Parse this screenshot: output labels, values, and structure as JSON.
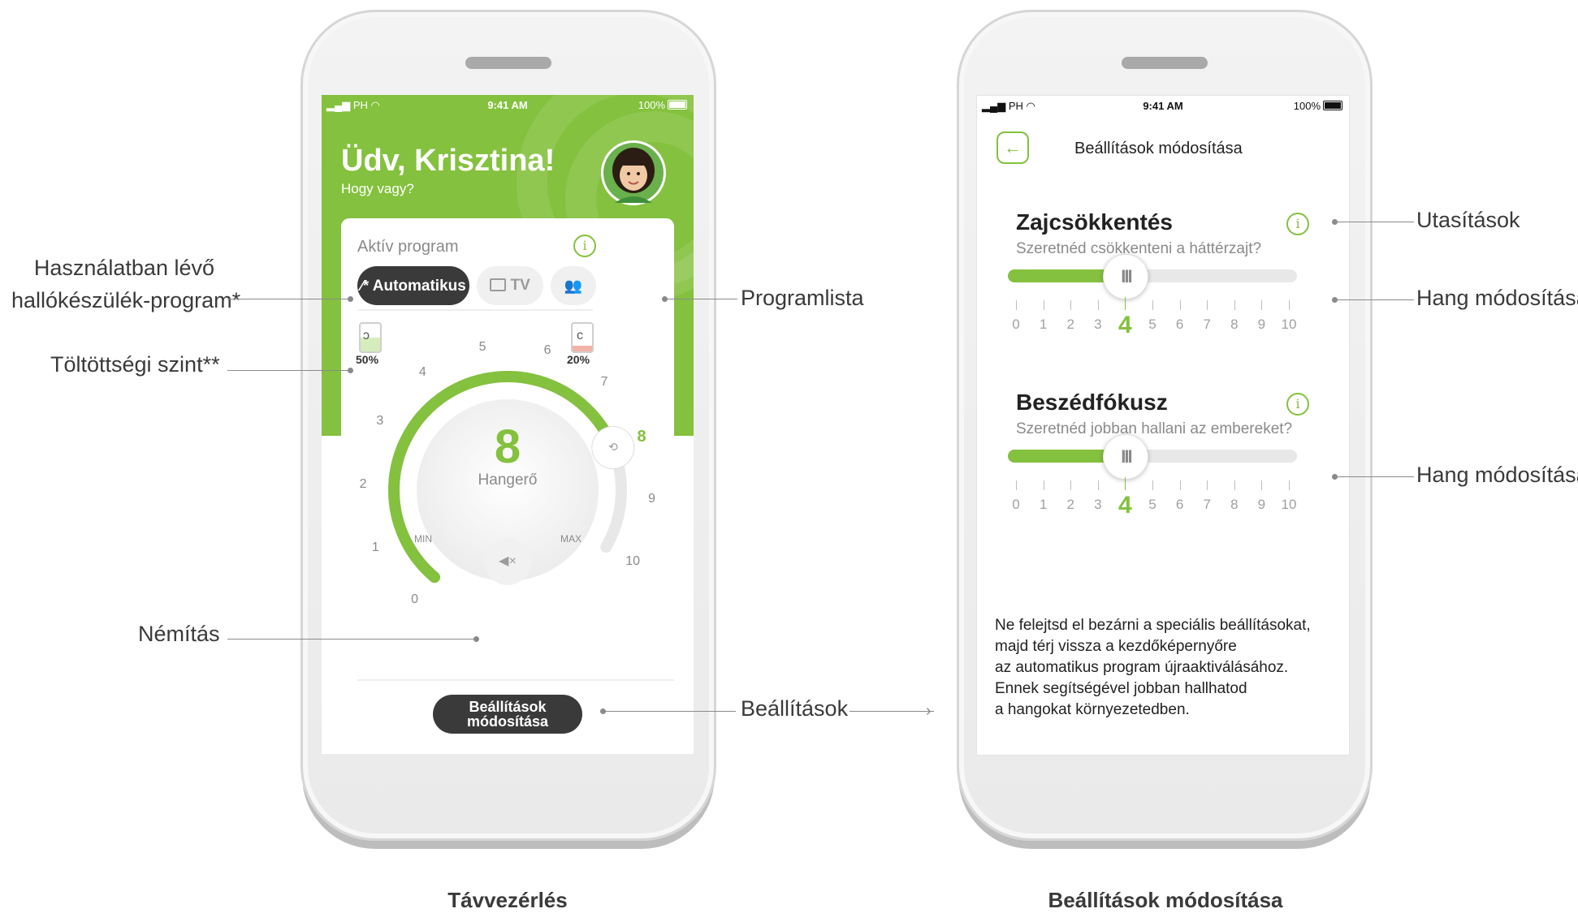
{
  "colors": {
    "accent": "#84c13e",
    "dark": "#3a3a3a",
    "low_battery": "#f2b3a8"
  },
  "left_phone": {
    "status": {
      "signal": "PH",
      "time": "9:41 AM",
      "battery": "100%"
    },
    "greeting": "Üdv, Krisztina!",
    "subgreeting": "Hogy vagy?",
    "active_program_label": "Aktív program",
    "programs": [
      {
        "label": "Automatikus",
        "icon": "magic-wand-icon",
        "active": true
      },
      {
        "label": "TV",
        "icon": "tv-icon",
        "active": false
      },
      {
        "label": "",
        "icon": "people-icon",
        "active": false
      }
    ],
    "battery_left": {
      "percent": "50%",
      "level": 0.5
    },
    "battery_right": {
      "percent": "20%",
      "level": 0.2
    },
    "volume": {
      "value": "8",
      "label": "Hangerő",
      "min_label": "MIN",
      "max_label": "MAX",
      "scale": [
        "0",
        "1",
        "2",
        "3",
        "4",
        "5",
        "6",
        "7",
        "8",
        "9",
        "10"
      ]
    },
    "mute_icon": "mute-icon",
    "settings_button": [
      "Beállítások",
      "módosítása"
    ]
  },
  "right_phone": {
    "status": {
      "signal": "PH",
      "time": "9:41 AM",
      "battery": "100%"
    },
    "title": "Beállítások módosítása",
    "sections": [
      {
        "title": "Zajcsökkentés",
        "subtitle": "Szeretnéd csökkenteni a háttérzajt?",
        "value": 4,
        "scale": [
          "0",
          "1",
          "2",
          "3",
          "4",
          "5",
          "6",
          "7",
          "8",
          "9",
          "10"
        ]
      },
      {
        "title": "Beszédfókusz",
        "subtitle": "Szeretnéd jobban hallani az embereket?",
        "value": 4,
        "scale": [
          "0",
          "1",
          "2",
          "3",
          "4",
          "5",
          "6",
          "7",
          "8",
          "9",
          "10"
        ]
      }
    ],
    "note": [
      "Ne felejtsd el bezárni a speciális beállításokat,",
      "majd térj vissza a kezdőképernyőre",
      "az automatikus program újraaktiválásához.",
      "Ennek segítségével jobban hallhatod",
      "a hangokat környezetedben."
    ]
  },
  "annotations": {
    "program_in_use": [
      "Használatban lévő",
      "hallókészülék-program*"
    ],
    "battery_level": "Töltöttségi szint**",
    "mute": "Némítás",
    "program_list": "Programlista",
    "settings": "Beállítások",
    "instructions": "Utasítások",
    "sound_adjust_1": "Hang módosítása",
    "sound_adjust_2": "Hang módosítása"
  },
  "captions": {
    "left": "Távvezérlés",
    "right": "Beállítások módosítása"
  }
}
